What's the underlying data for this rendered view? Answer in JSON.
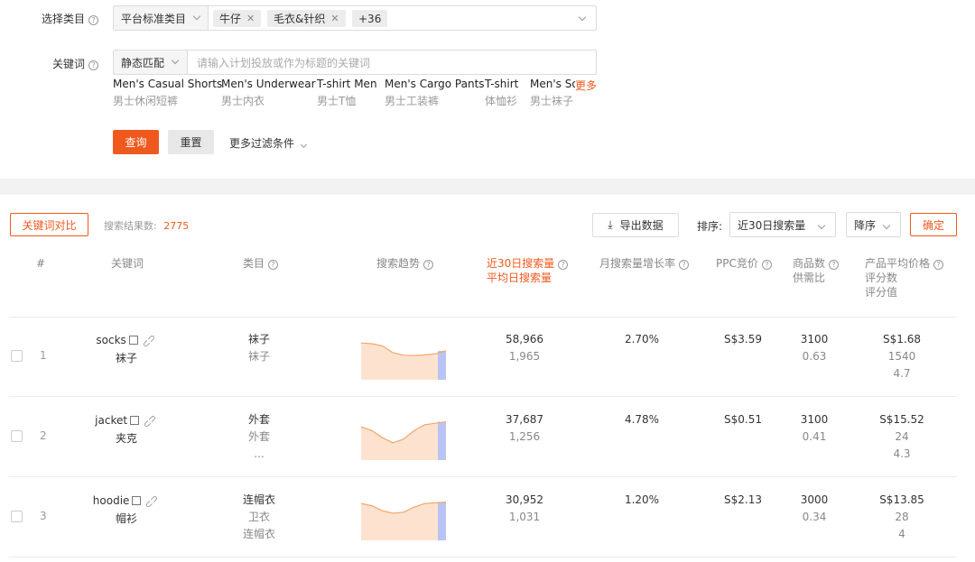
{
  "filters": {
    "category_label": "选择类目",
    "category_platform": "平台标准类目",
    "category_tags": [
      "牛仔",
      "毛衣&针织"
    ],
    "category_more": "+36",
    "keyword_label": "关键词",
    "match_mode": "静态匹配",
    "keyword_placeholder": "请输入计划投放或作为标题的关键词",
    "suggestions": [
      {
        "en": "Men's Casual Shorts",
        "zh": "男士休闲短裤"
      },
      {
        "en": "Men's Underwear",
        "zh": "男士内衣"
      },
      {
        "en": "T-shirt Men",
        "zh": "男士T恤"
      },
      {
        "en": "Men's Cargo Pants",
        "zh": "男士工装裤"
      },
      {
        "en": "T-shirt",
        "zh": "体恤衫"
      },
      {
        "en": "Men's Soc",
        "zh": "男士袜子"
      }
    ],
    "more_label": "更多",
    "query_button": "查询",
    "reset_button": "重置",
    "more_filters": "更多过滤条件"
  },
  "toolbar": {
    "compare_button": "关键词对比",
    "result_count_label": "搜索结果数:",
    "result_count": "2775",
    "export_button": "导出数据",
    "sort_label": "排序:",
    "sort_field": "近30日搜索量",
    "sort_order": "降序",
    "confirm_button": "确定"
  },
  "table": {
    "headers": {
      "rank": "#",
      "keyword": "关键词",
      "category": "类目",
      "trend": "搜索趋势",
      "volume_line1": "近30日搜索量",
      "volume_line2": "平均日搜索量",
      "growth": "月搜索量增长率",
      "ppc": "PPC竞价",
      "products_line1": "商品数",
      "products_line2": "供需比",
      "price_line1": "产品平均价格",
      "price_line2": "评分数",
      "price_line3": "评分值"
    },
    "rows": [
      {
        "rank": "1",
        "keyword": "socks",
        "keyword_zh": "袜子",
        "category": [
          "袜子",
          "袜子"
        ],
        "volume": "58,966",
        "avg_daily": "1,965",
        "growth": "2.70%",
        "ppc": "S$3.59",
        "products": "3100",
        "supply_ratio": "0.63",
        "price": "S$1.68",
        "rating_count": "1540",
        "rating": "4.7",
        "trend": [
          0.82,
          0.8,
          0.74,
          0.55,
          0.48,
          0.47,
          0.49,
          0.52,
          0.6
        ]
      },
      {
        "rank": "2",
        "keyword": "jacket",
        "keyword_zh": "夹克",
        "category": [
          "外套",
          "外套",
          "..."
        ],
        "volume": "37,687",
        "avg_daily": "1,256",
        "growth": "4.78%",
        "ppc": "S$0.51",
        "products": "3100",
        "supply_ratio": "0.41",
        "price": "S$15.52",
        "rating_count": "24",
        "rating": "4.3",
        "trend": [
          0.72,
          0.62,
          0.42,
          0.28,
          0.38,
          0.62,
          0.78,
          0.82,
          0.86
        ]
      },
      {
        "rank": "3",
        "keyword": "hoodie",
        "keyword_zh": "帽衫",
        "category": [
          "连帽衣",
          "卫衣",
          "连帽衣"
        ],
        "volume": "30,952",
        "avg_daily": "1,031",
        "growth": "1.20%",
        "ppc": "S$2.13",
        "products": "3000",
        "supply_ratio": "0.34",
        "price": "S$13.85",
        "rating_count": "28",
        "rating": "4",
        "trend": [
          0.82,
          0.76,
          0.62,
          0.55,
          0.58,
          0.72,
          0.82,
          0.84,
          0.86
        ]
      }
    ]
  },
  "colors": {
    "accent": "#f0591e",
    "trend_fill": "#fde3cf",
    "trend_line": "#f5a46b",
    "trend_recent": "#b9c4f5"
  }
}
